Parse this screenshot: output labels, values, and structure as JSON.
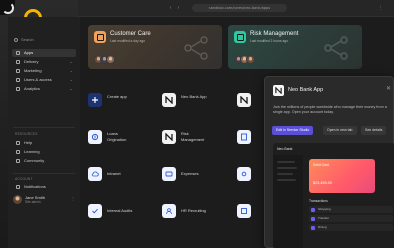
{
  "browser": {
    "url": "sandbox.com/cores/neo-bank/apps"
  },
  "sidebar": {
    "search_placeholder": "Search",
    "items": [
      {
        "label": "Apps",
        "active": true
      },
      {
        "label": "Delivery"
      },
      {
        "label": "Marketing"
      },
      {
        "label": "Users & access"
      },
      {
        "label": "Analytics"
      }
    ],
    "section_label": "RESOURCES",
    "resources": [
      {
        "label": "Help"
      },
      {
        "label": "Learning"
      },
      {
        "label": "Community"
      }
    ],
    "account_label": "ACCOUNT",
    "account_items": [
      {
        "label": "Notifications"
      }
    ],
    "user": {
      "name": "Jane Smith",
      "role": "Site admin"
    }
  },
  "featured": [
    {
      "title": "Customer Care",
      "subtitle": "Last modified a day ago"
    },
    {
      "title": "Risk Management",
      "subtitle": "Last modified 2 hours ago"
    }
  ],
  "apps": [
    {
      "label": "Create app"
    },
    {
      "label": "Neo Bank App"
    },
    {
      "label": "Loans\nOrigination"
    },
    {
      "label": "Risk\nManagement"
    },
    {
      "label": "Intranet"
    },
    {
      "label": "Expenses"
    },
    {
      "label": "Internal Audits"
    },
    {
      "label": "HR Recruiting"
    }
  ],
  "popup": {
    "title": "Neo Bank App",
    "description": "Join the millions of people worldwide who manage their money from a single app. Open your account today.",
    "buttons": {
      "primary": "Edit in Service Studio",
      "secondary": "Open in new tab",
      "tertiary": "See details"
    },
    "preview": {
      "header": "Neo Bank",
      "card_title": "Debit Card",
      "card_amount": "$25,450.00",
      "section": "Transactions",
      "rows": [
        "Shopping",
        "Transfer",
        "Dining"
      ]
    }
  },
  "colors": {
    "accent": "#5a4fd6",
    "customer_care": "#f1a15a",
    "risk_management": "#2ec9a3",
    "logo": "#f5b400"
  }
}
